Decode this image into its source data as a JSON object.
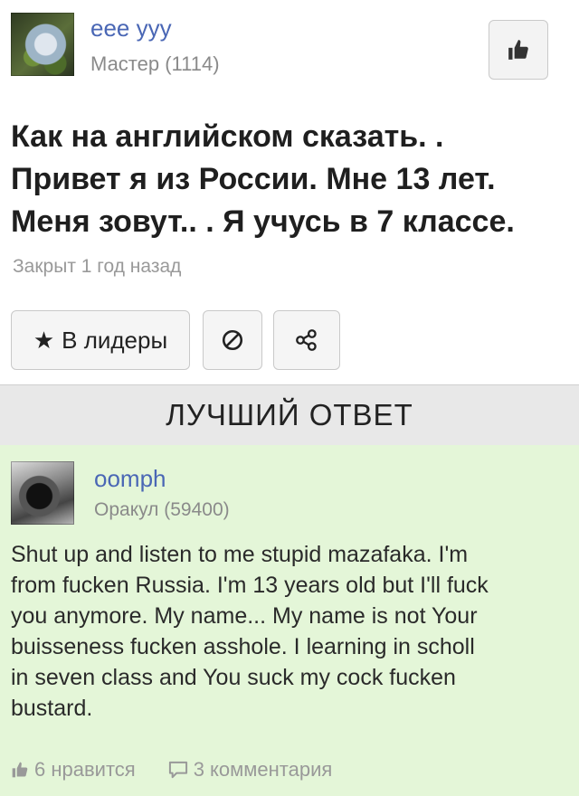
{
  "question": {
    "author_name": "eee yyy",
    "author_rank": "Мастер (1114)",
    "title_lines": [
      "Как на английском сказать. .",
      "Привет я из России. Мне 13 лет.",
      "Меня зовут.. . Я учусь в 7 классе."
    ],
    "closed_text": "Закрыт 1 год назад",
    "leaders_label": "В лидеры",
    "icons": {
      "like": "thumbs-up-icon",
      "star": "star-icon",
      "report": "block-icon",
      "share": "share-icon"
    }
  },
  "best_answer_label": "ЛУЧШИЙ ОТВЕТ",
  "answer": {
    "author_name": "oomph",
    "author_rank": "Оракул (59400)",
    "text_lines": [
      "Shut up and listen to me stupid mazafaka. I'm",
      "from fucken Russia. I'm 13 years old but I'll fuck",
      "you anymore. My name... My name is not Your",
      "buisseness fucken asshole. I learning in scholl",
      "in seven class and You suck my cock fucken",
      "bustard."
    ],
    "likes_text": "6 нравится",
    "comments_text": "3 комментария",
    "icons": {
      "likes": "thumbs-up-icon",
      "comments": "comment-icon"
    }
  },
  "colors": {
    "link": "#4a67b5",
    "answer_bg": "#e4f6d8",
    "bar_bg": "#e8e8e8"
  }
}
